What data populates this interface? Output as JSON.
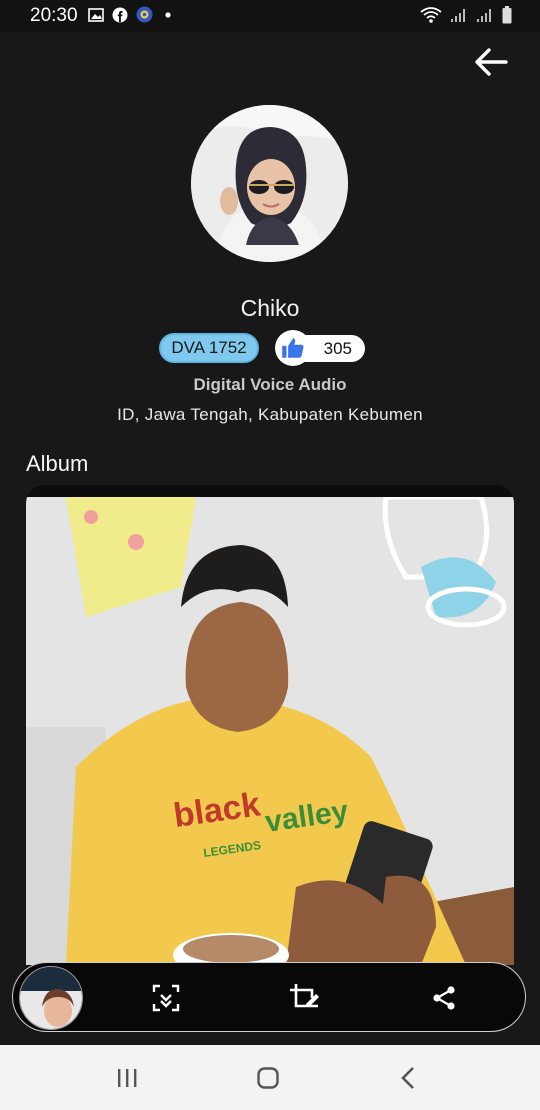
{
  "status_bar": {
    "time": "20:30"
  },
  "profile": {
    "name": "Chiko",
    "badge": "DVA 1752",
    "likes": "305",
    "organization": "Digital Voice Audio",
    "location": "ID, Jawa Tengah, Kabupaten Kebumen"
  },
  "album": {
    "title": "Album",
    "photo_shirt_text_1": "black",
    "photo_shirt_text_2": "valley",
    "photo_shirt_text_3": "LEGENDS"
  },
  "toolbar": {
    "buttons": [
      "scan-icon",
      "crop-edit-icon",
      "share-icon"
    ]
  },
  "colors": {
    "background": "#181818",
    "badge": "#7fc9ee",
    "like": "#3b76e8"
  }
}
